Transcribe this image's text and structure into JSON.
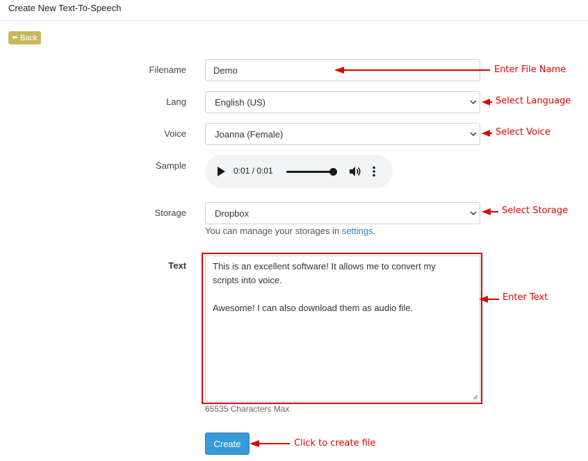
{
  "header": {
    "title": "Create New Text-To-Speech"
  },
  "nav": {
    "back_label": "Back"
  },
  "form": {
    "filename": {
      "label": "Filename",
      "value": "Demo"
    },
    "lang": {
      "label": "Lang",
      "selected": "English (US)"
    },
    "voice": {
      "label": "Voice",
      "selected": "Joanna (Female)"
    },
    "sample": {
      "label": "Sample",
      "time": "0:01 / 0:01",
      "progress": 1.0
    },
    "storage": {
      "label": "Storage",
      "selected": "Dropbox",
      "help_prefix": "You can manage your storages in ",
      "help_link": "settings",
      "help_suffix": "."
    },
    "text": {
      "label": "Text",
      "line1": "This is an excellent software! It allows me to convert my",
      "line2": "scripts into voice.",
      "line3": "Awesome! I can also download them as audio file.",
      "char_limit": "65535 Characters Max"
    },
    "create_label": "Create"
  },
  "annotations": {
    "filename": "Enter File Name",
    "language": "Select Language",
    "voice": "Select Voice",
    "storage": "Select Storage",
    "text": "Enter Text",
    "create": "Click to create file"
  },
  "colors": {
    "annotation": "#e00000",
    "back_button": "#c9b85a",
    "primary_button": "#3799d6",
    "link": "#2a86c4"
  }
}
